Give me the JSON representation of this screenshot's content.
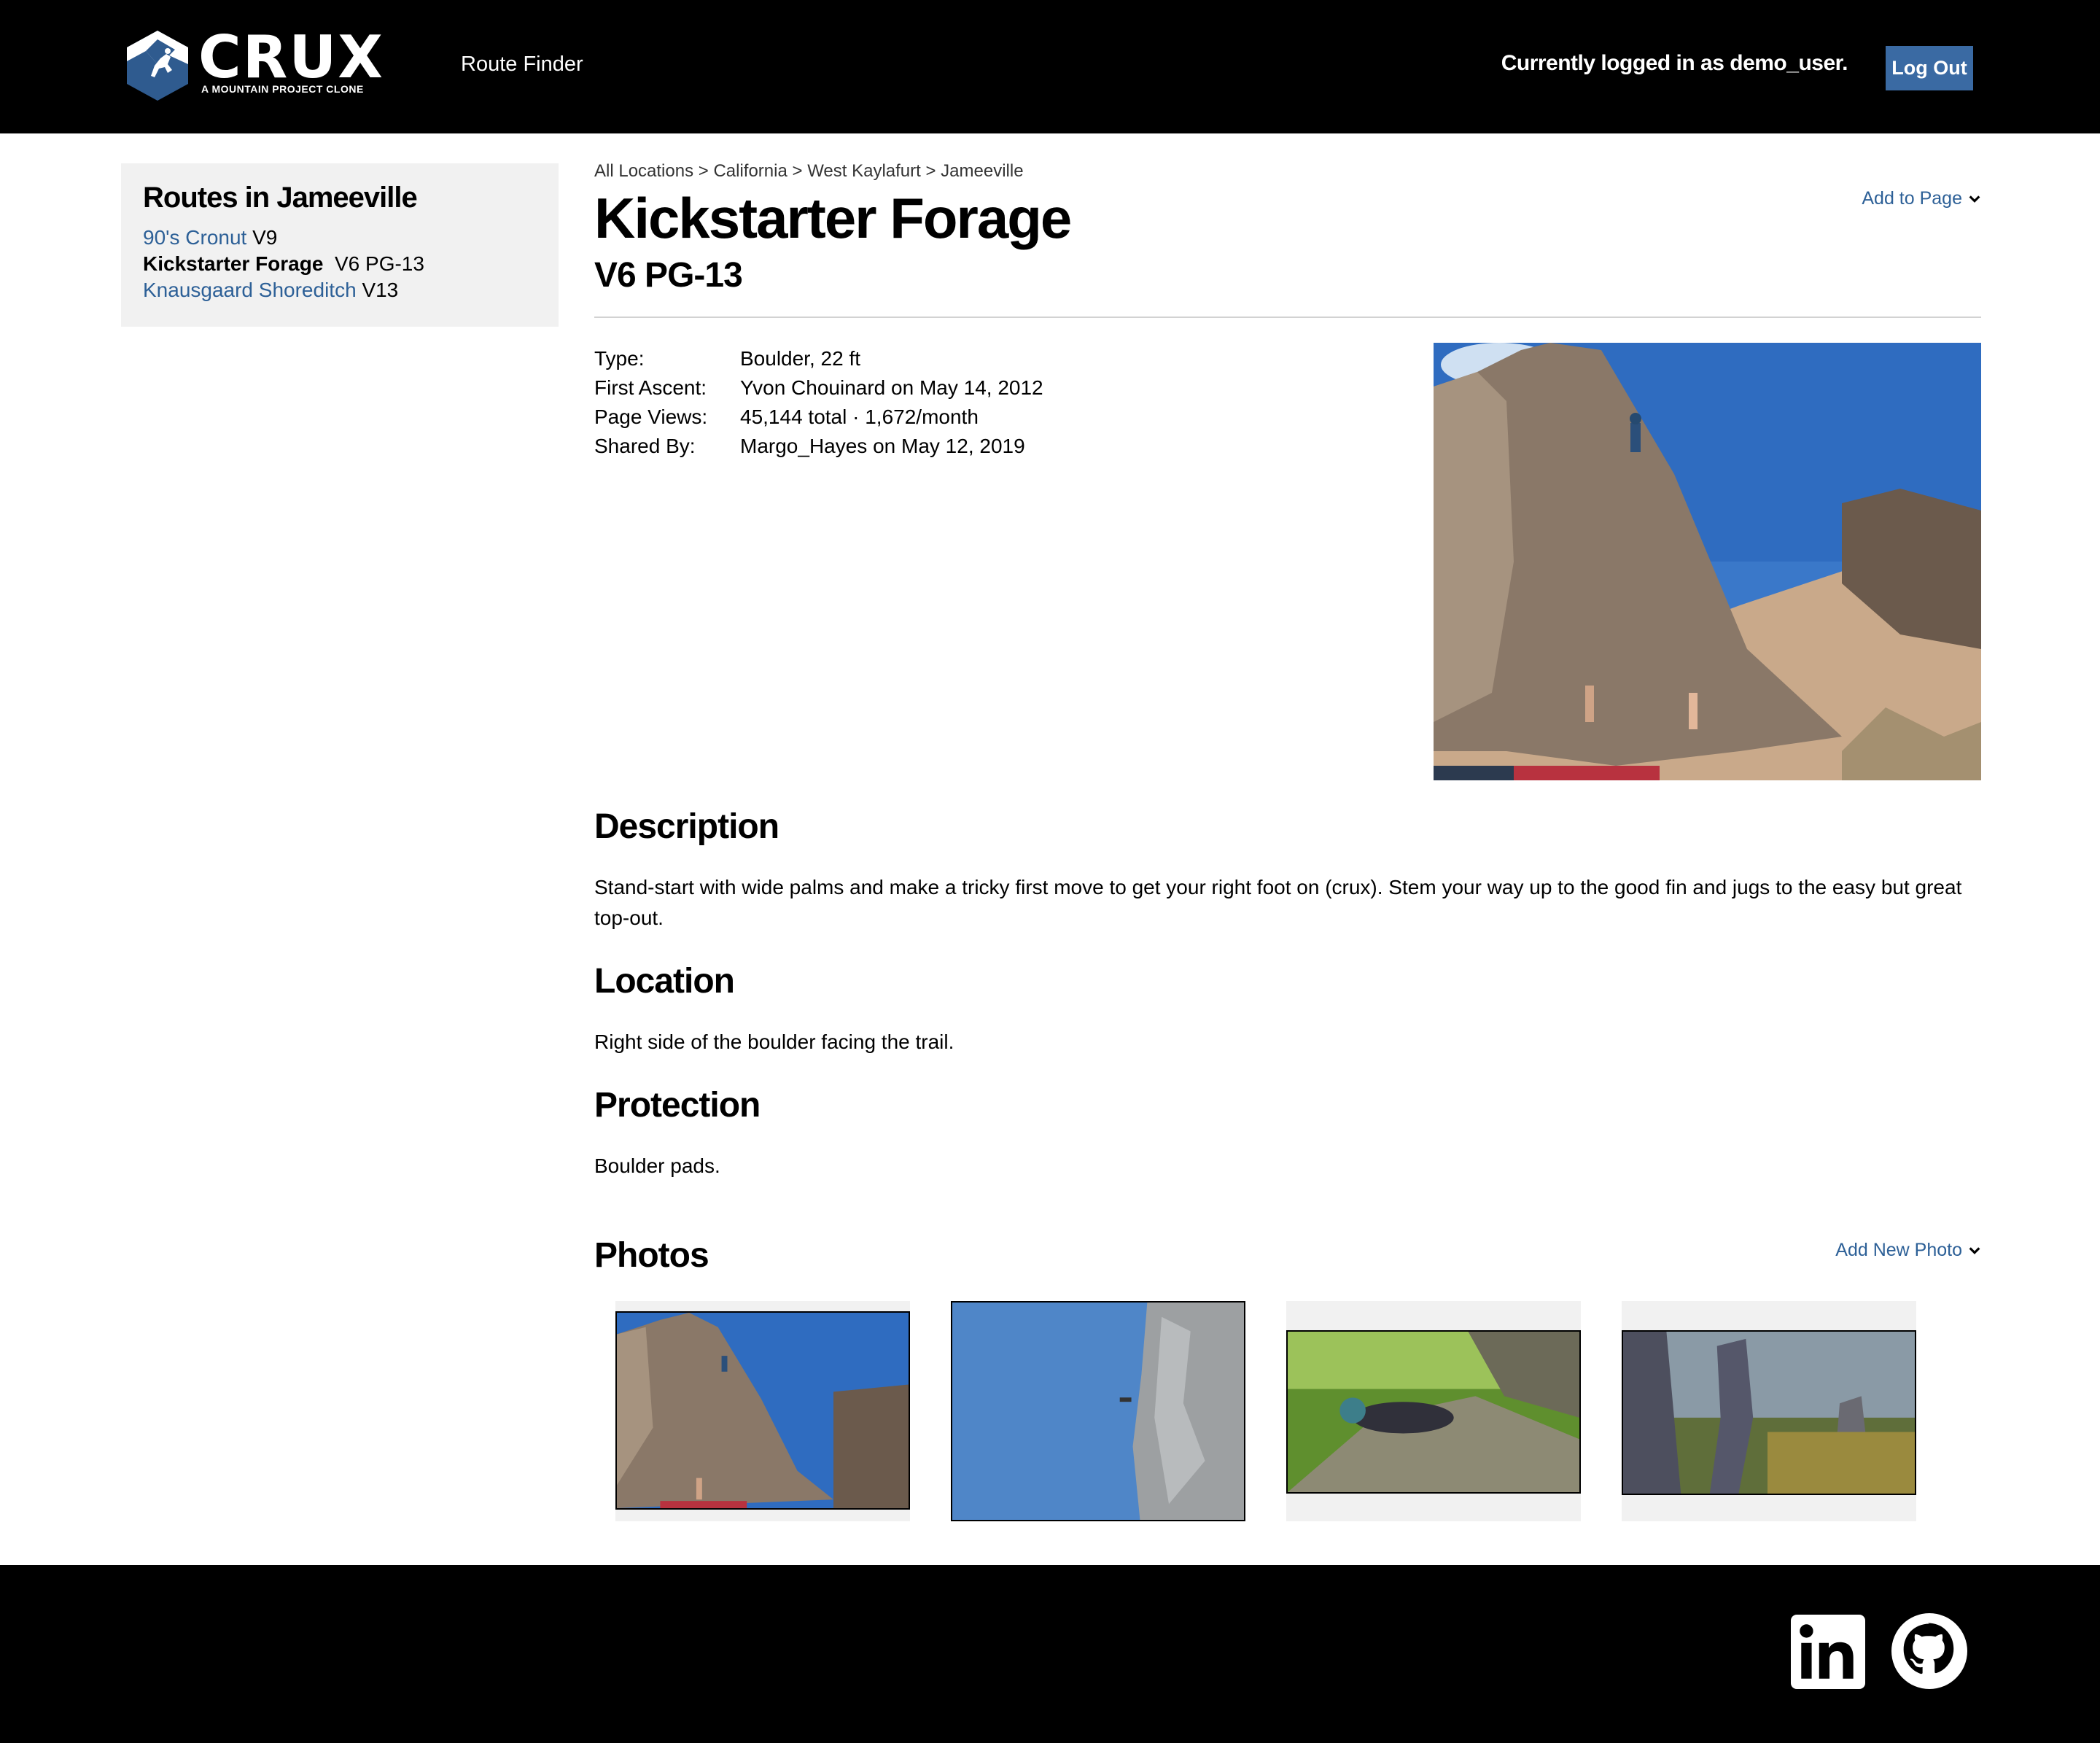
{
  "header": {
    "logo_word": "CRUX",
    "logo_tagline": "A MOUNTAIN PROJECT CLONE",
    "nav_route_finder": "Route Finder",
    "login_status": "Currently logged in as demo_user.",
    "logout_label": "Log Out"
  },
  "sidebar": {
    "title": "Routes in Jameeville",
    "routes": [
      {
        "name": "90's Cronut",
        "grade": "V9"
      },
      {
        "name": "Kickstarter Forage",
        "grade": "V6 PG-13"
      },
      {
        "name": "Knausgaard Shoreditch",
        "grade": "V13"
      }
    ]
  },
  "breadcrumb": {
    "items": [
      "All Locations",
      "California",
      "West Kaylafurt",
      "Jameeville"
    ],
    "separator": ">"
  },
  "route": {
    "title": "Kickstarter Forage",
    "grade": "V6 PG-13",
    "add_to_page_label": "Add to Page",
    "details": [
      {
        "label": "Type:",
        "value": "Boulder, 22 ft"
      },
      {
        "label": "First Ascent:",
        "value": "Yvon Chouinard on May 14, 2012"
      },
      {
        "label": "Page Views:",
        "value": "45,144 total · 1,672/month"
      },
      {
        "label": "Shared By:",
        "value": "Margo_Hayes on May 12, 2019"
      }
    ]
  },
  "sections": {
    "description_title": "Description",
    "description_text": "Stand-start with wide palms and make a tricky first move to get your right foot on (crux). Stem your way up to the good fin and jugs to the easy but great top-out.",
    "location_title": "Location",
    "location_text": "Right side of the boulder facing the trail.",
    "protection_title": "Protection",
    "protection_text": "Boulder pads."
  },
  "photos": {
    "title": "Photos",
    "add_new_label": "Add New Photo"
  },
  "colors": {
    "header_bg": "#000000",
    "accent_link": "#2d6097",
    "button_bg": "#3a6aa3",
    "sidebar_bg": "#f1f1f1"
  },
  "icons": [
    "crux-logo-icon",
    "chevron-down-icon",
    "linkedin-icon",
    "github-icon"
  ]
}
